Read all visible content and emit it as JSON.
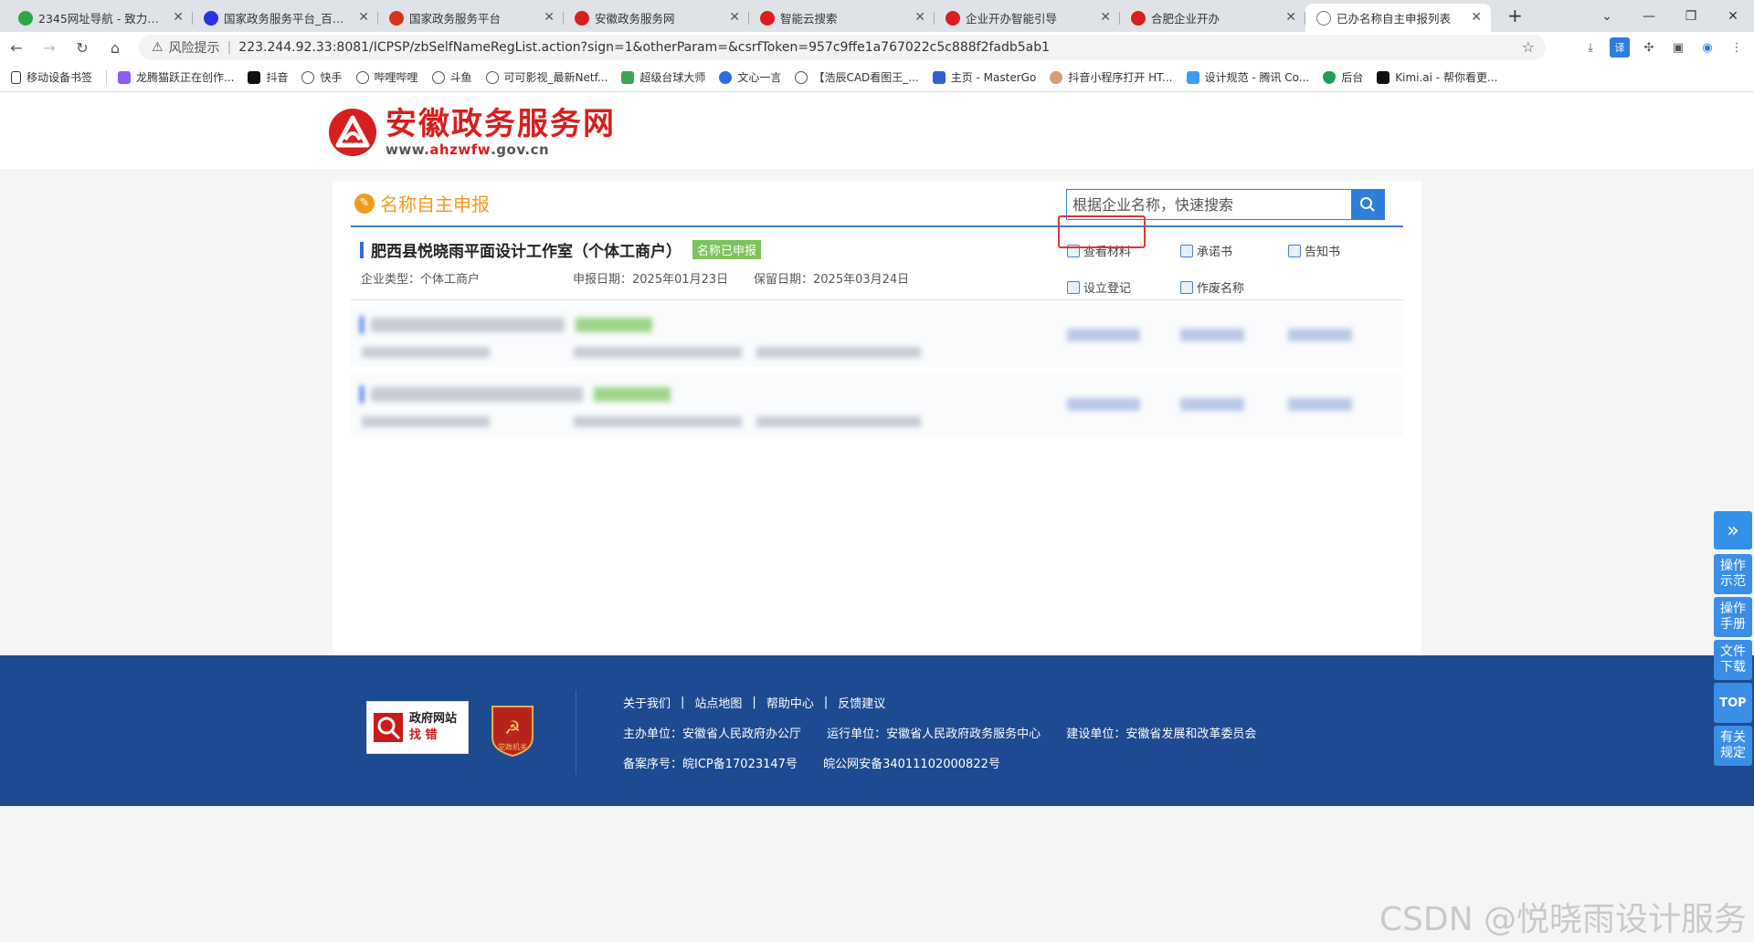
{
  "browser": {
    "tabs": [
      {
        "title": "2345网址导航 - 致力于打...",
        "icon_color": "#2aa845"
      },
      {
        "title": "国家政务服务平台_百度搜...",
        "icon_color": "#2932e1"
      },
      {
        "title": "国家政务服务平台",
        "icon_color": "#d8341c"
      },
      {
        "title": "安徽政务服务网",
        "icon_color": "#d81e1e"
      },
      {
        "title": "智能云搜索",
        "icon_color": "#d81e1e"
      },
      {
        "title": "企业开办智能引导",
        "icon_color": "#d81e1e"
      },
      {
        "title": "合肥企业开办",
        "icon_color": "#d81e1e"
      },
      {
        "title": "已办名称自主申报列表",
        "icon_color": "#777777"
      }
    ],
    "risk_label": "风险提示",
    "url": "223.244.92.33:8081/ICPSP/zbSelfNameRegList.action?sign=1&otherParam=&csrfToken=957c9ffe1a767022c5c888f2fadb5ab1",
    "bookmarks": [
      "移动设备书签",
      "龙腾猫跃正在创作...",
      "抖音",
      "快手",
      "哔哩哔哩",
      "斗鱼",
      "可可影视_最新Netf...",
      "超级台球大师",
      "文心一言",
      "【浩辰CAD看图王_...",
      "主页 - MasterGo",
      "抖音小程序打开 HT...",
      "设计规范 - 腾讯 Co...",
      "后台",
      "Kimi.ai - 帮你看更..."
    ]
  },
  "site": {
    "logo_cn": "安徽政务服务网",
    "logo_url_prefix": "www.",
    "logo_url_brand": "ahzwfw",
    "logo_url_suffix": ".gov.cn",
    "brand_color": "#d81e1e"
  },
  "panel": {
    "title": "名称自主申报",
    "search_placeholder": "根据企业名称，快速搜索"
  },
  "records": [
    {
      "name": "肥西县悦晓雨平面设计工作室（个体工商户）",
      "badge": "名称已申报",
      "type_label": "企业类型：个体工商户",
      "apply_date": "申报日期：2025年01月23日",
      "keep_date": "保留日期：2025年03月24日",
      "actions": [
        "查看材料",
        "承诺书",
        "告知书",
        "设立登记",
        "作废名称"
      ]
    }
  ],
  "footer": {
    "gov_err_line1": "政府网站",
    "gov_err_line2": "找 错",
    "party_label": "党政机关",
    "links": [
      "关于我们",
      "站点地图",
      "帮助中心",
      "反馈建议"
    ],
    "sponsor": "主办单位：安徽省人民政府办公厅",
    "operator": "运行单位：安徽省人民政府政务服务中心",
    "builder": "建设单位：安徽省发展和改革委员会",
    "icp": "备案序号：皖ICP备17023147号",
    "police": "皖公网安备34011102000822号"
  },
  "float_menu": [
    "操作示范",
    "操作手册",
    "文件下载",
    "TOP",
    "有关规定"
  ],
  "watermark": "CSDN @悦晓雨设计服务"
}
